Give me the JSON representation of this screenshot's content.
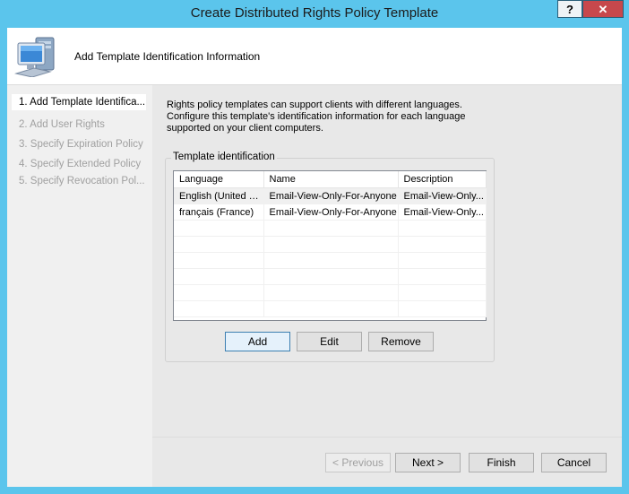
{
  "window": {
    "title": "Create Distributed Rights Policy Template",
    "help_label": "?",
    "close_label": "✕"
  },
  "header": {
    "text": "Add Template Identification Information",
    "icon": "computer-icon"
  },
  "nav": {
    "items": [
      {
        "label": "1. Add Template Identifica...",
        "active": true
      },
      {
        "label": "2. Add User Rights"
      },
      {
        "label": "3. Specify Expiration Policy"
      },
      {
        "label": "4. Specify Extended Policy"
      },
      {
        "label": "5. Specify Revocation Pol..."
      }
    ]
  },
  "main": {
    "intro": "Rights policy templates can support clients with different languages. Configure this template's identification information for each language supported on your client computers.",
    "group_label": "Template identification",
    "columns": [
      "Language",
      "Name",
      "Description"
    ],
    "rows": [
      [
        "English (United S...",
        "Email-View-Only-For-Anyone",
        "Email-View-Only..."
      ],
      [
        "français (France)",
        "Email-View-Only-For-Anyone",
        "Email-View-Only..."
      ]
    ],
    "add_label": "Add",
    "edit_label": "Edit",
    "remove_label": "Remove"
  },
  "footer": {
    "previous_label": "< Previous",
    "next_label": "Next >",
    "finish_label": "Finish",
    "cancel_label": "Cancel"
  }
}
